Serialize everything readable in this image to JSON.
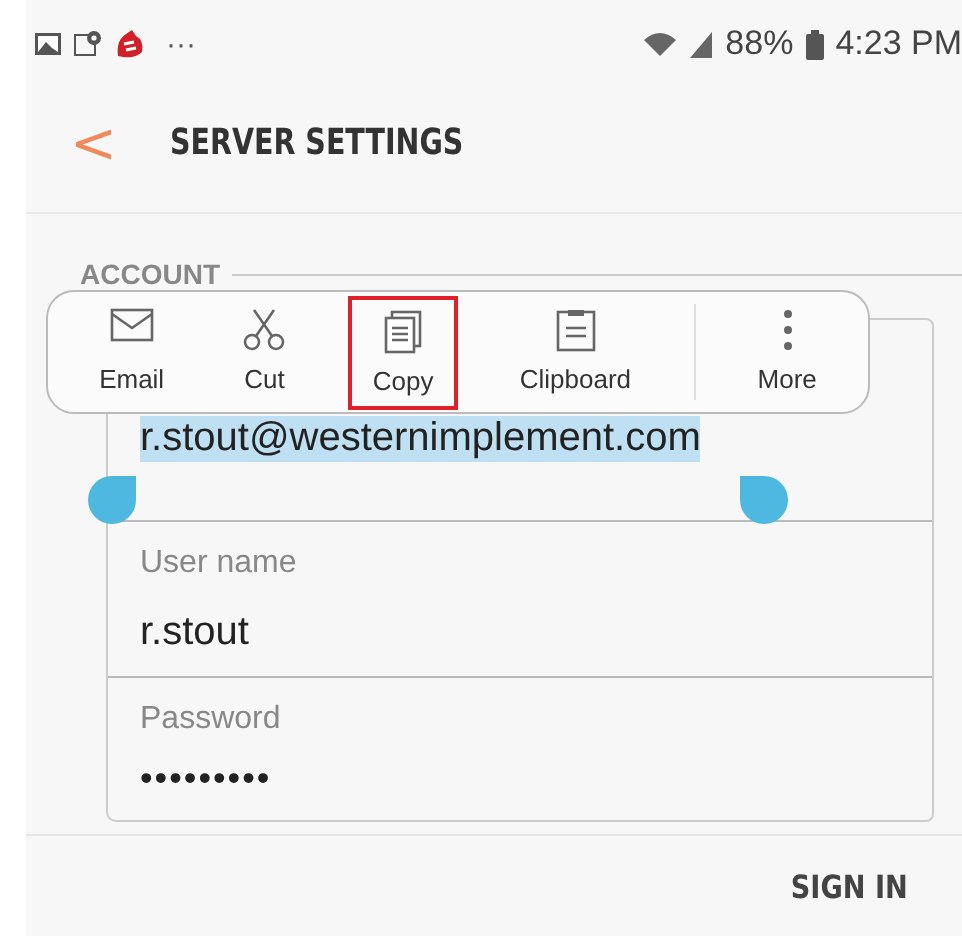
{
  "status_bar": {
    "more": "···",
    "battery": "88%",
    "time": "4:23 PM"
  },
  "header": {
    "back": "<",
    "title": "SERVER SETTINGS"
  },
  "section": {
    "title": "ACCOUNT"
  },
  "text_toolbar": [
    {
      "kind": "email",
      "label": "Email",
      "highlighted": false
    },
    {
      "kind": "cut",
      "label": "Cut",
      "highlighted": false
    },
    {
      "kind": "copy",
      "label": "Copy",
      "highlighted": true
    },
    {
      "kind": "clipboard",
      "label": "Clipboard",
      "highlighted": false
    },
    {
      "kind": "more",
      "label": "More",
      "highlighted": false
    }
  ],
  "fields": [
    {
      "value": "r.stout@westernimplement.com",
      "selected": true
    },
    {
      "label": "User name",
      "value": "r.stout",
      "selected": false
    },
    {
      "label": "Password",
      "value": "•••••••••",
      "selected": false
    }
  ],
  "action": "SIGN IN"
}
